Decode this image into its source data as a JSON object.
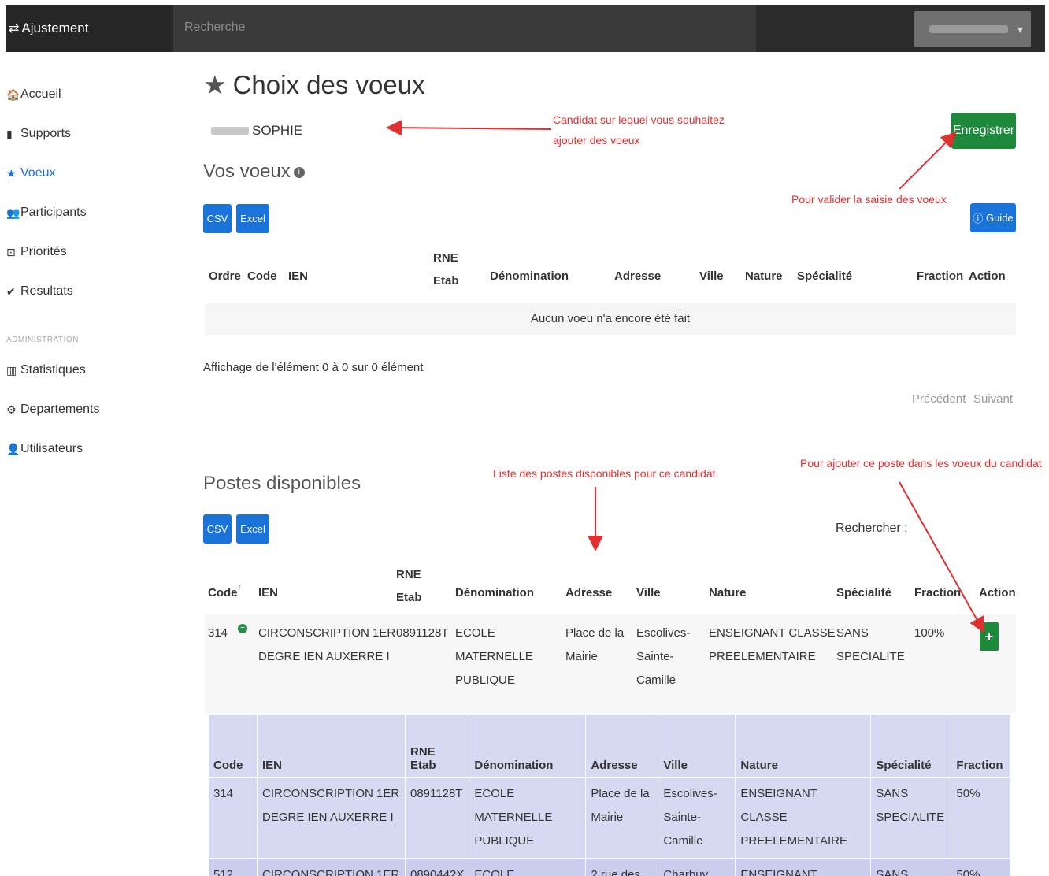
{
  "topbar": {
    "brand": "Ajustement",
    "search_placeholder": "Recherche"
  },
  "sidebar": {
    "items": [
      {
        "label": "Accueil",
        "icon": "home-icon",
        "glyph": "🏠"
      },
      {
        "label": "Supports",
        "icon": "file-icon",
        "glyph": "▮"
      },
      {
        "label": "Voeux",
        "icon": "star-icon",
        "glyph": "★",
        "active": true
      },
      {
        "label": "Participants",
        "icon": "users-icon",
        "glyph": "👥"
      },
      {
        "label": "Priorités",
        "icon": "priority-icon",
        "glyph": "⊡"
      },
      {
        "label": "Resultats",
        "icon": "check-circle-icon",
        "glyph": "✔"
      }
    ],
    "section_label": "ADMINISTRATION",
    "admin_items": [
      {
        "label": "Statistiques",
        "icon": "chart-icon",
        "glyph": "▥"
      },
      {
        "label": "Departements",
        "icon": "cogs-icon",
        "glyph": "⚙"
      },
      {
        "label": "Utilisateurs",
        "icon": "user-admin-icon",
        "glyph": "👤"
      }
    ]
  },
  "main": {
    "title": "Choix des voeux",
    "candidate_name": "SOPHIE",
    "save_label": "Enregistrer",
    "vos_voeux_title": "Vos voeux",
    "csv_label": "CSV",
    "excel_label": "Excel",
    "guide_label": "Guide",
    "voeux_headers": [
      "Ordre",
      "Code",
      "IEN",
      "RNE\nEtab",
      "Dénomination",
      "Adresse",
      "Ville",
      "Nature",
      "Spécialité",
      "Fraction",
      "Action"
    ],
    "empty_message": "Aucun voeu n'a encore été fait",
    "info_text": "Affichage de l'élément 0 à 0 sur 0 élément",
    "prev_label": "Précédent",
    "next_label": "Suivant",
    "postes_title": "Postes disponibles",
    "search_label": "Rechercher :",
    "postes_headers": [
      "Code",
      "IEN",
      "RNE\nEtab",
      "Dénomination",
      "Adresse",
      "Ville",
      "Nature",
      "Spécialité",
      "Fraction",
      "Action"
    ],
    "poste_row": {
      "code": "314",
      "ien": "CIRCONSCRIPTION 1ER\nDEGRE IEN AUXERRE I",
      "rne": "0891128T",
      "denomination": "ECOLE\nMATERNELLE\nPUBLIQUE",
      "adresse": "Place de la\nMairie",
      "ville": "Escolives-\nSainte-\nCamille",
      "nature": "ENSEIGNANT CLASSE\nPREELEMENTAIRE",
      "specialite": "SANS\nSPECIALITE",
      "fraction": "100%",
      "action": "+"
    },
    "sub_headers": [
      "Code",
      "IEN",
      "RNE\nEtab",
      "Dénomination",
      "Adresse",
      "Ville",
      "Nature",
      "Spécialité",
      "Fraction"
    ],
    "sub_rows": [
      [
        "314",
        "CIRCONSCRIPTION 1ER\nDEGRE IEN AUXERRE I",
        "0891128T",
        "ECOLE MATERNELLE\nPUBLIQUE",
        "Place de la\nMairie",
        "Escolives-\nSainte-Camille",
        "ENSEIGNANT CLASSE\nPREELEMENTAIRE",
        "SANS\nSPECIALITE",
        "50%"
      ],
      [
        "512",
        "CIRCONSCRIPTION 1ER",
        "0890442X",
        "ECOLE",
        "2 rue des",
        "Charbuy",
        "ENSEIGNANT CLASSE",
        "SANS",
        "50%"
      ]
    ]
  },
  "annotations": {
    "candidate": "Candidat sur lequel vous souhaitez\najouter des voeux",
    "validate": "Pour valider la saisie des voeux",
    "list": "Liste des postes disponibles pour ce candidat",
    "add": "Pour ajouter ce poste dans les voeux du candidat"
  },
  "colors": {
    "annotation": "#e03030",
    "primary": "#1a73d9",
    "success": "#1d8a3b"
  }
}
